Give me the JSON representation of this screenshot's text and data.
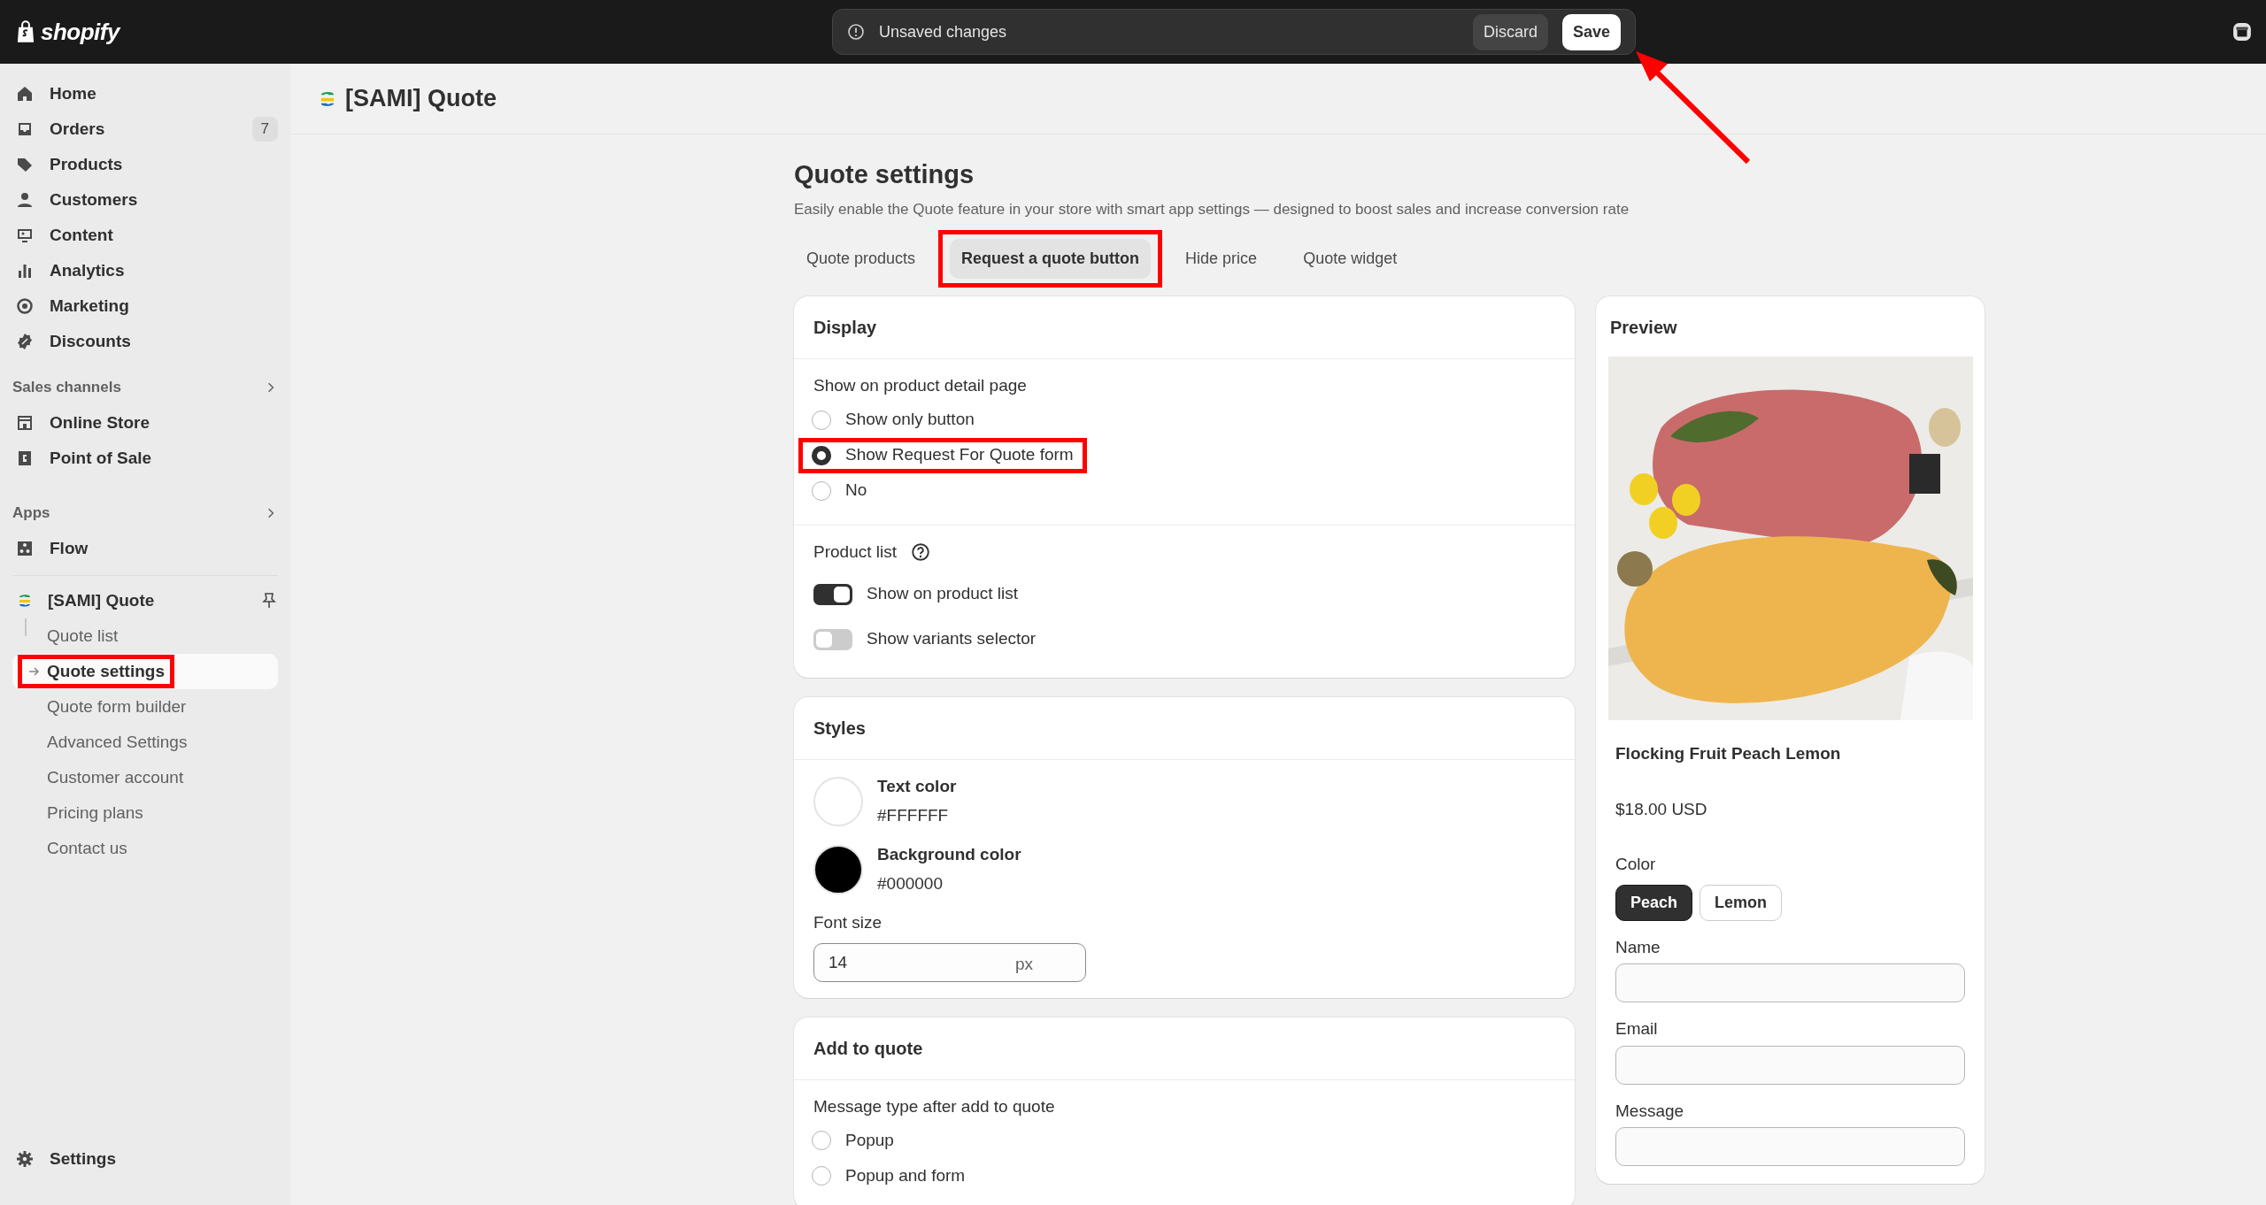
{
  "topbar": {
    "logo": "shopify",
    "message": "Unsaved changes",
    "discard": "Discard",
    "save": "Save"
  },
  "sidebar": {
    "items": [
      {
        "label": "Home"
      },
      {
        "label": "Orders",
        "badge": "7"
      },
      {
        "label": "Products"
      },
      {
        "label": "Customers"
      },
      {
        "label": "Content"
      },
      {
        "label": "Analytics"
      },
      {
        "label": "Marketing"
      },
      {
        "label": "Discounts"
      }
    ],
    "sections": [
      {
        "title": "Sales channels",
        "items": [
          {
            "label": "Online Store"
          },
          {
            "label": "Point of Sale"
          }
        ]
      },
      {
        "title": "Apps",
        "items": [
          {
            "label": "Flow"
          }
        ]
      }
    ],
    "app": {
      "label": "[SAMI] Quote",
      "children": [
        {
          "label": "Quote list",
          "selected": false,
          "highlighted": false
        },
        {
          "label": "Quote settings",
          "selected": true,
          "highlighted": true
        },
        {
          "label": "Quote form builder",
          "selected": false,
          "highlighted": false
        },
        {
          "label": "Advanced Settings",
          "selected": false,
          "highlighted": false
        },
        {
          "label": "Customer account",
          "selected": false,
          "highlighted": false
        },
        {
          "label": "Pricing plans",
          "selected": false,
          "highlighted": false
        },
        {
          "label": "Contact us",
          "selected": false,
          "highlighted": false
        }
      ]
    },
    "footer": "Settings"
  },
  "header": {
    "title": "[SAMI] Quote"
  },
  "page": {
    "title": "Quote settings",
    "subtitle": "Easily enable the Quote feature in your store with smart app settings — designed to boost sales and increase conversion rate"
  },
  "tabs": [
    {
      "label": "Quote products",
      "selected": false,
      "highlighted": false
    },
    {
      "label": "Request a quote button",
      "selected": true,
      "highlighted": true
    },
    {
      "label": "Hide price",
      "selected": false,
      "highlighted": false
    },
    {
      "label": "Quote widget",
      "selected": false,
      "highlighted": false
    }
  ],
  "display": {
    "title": "Display",
    "question": "Show on product detail page",
    "options": [
      {
        "label": "Show only button",
        "selected": false,
        "highlighted": false
      },
      {
        "label": "Show Request For Quote form",
        "selected": true,
        "highlighted": true
      },
      {
        "label": "No",
        "selected": false,
        "highlighted": false
      }
    ],
    "product_list_label": "Product list",
    "toggles": [
      {
        "label": "Show on product list",
        "on": true
      },
      {
        "label": "Show variants selector",
        "on": false
      }
    ]
  },
  "styles": {
    "title": "Styles",
    "colors": [
      {
        "label": "Text color",
        "value": "#FFFFFF",
        "color": "#ffffff"
      },
      {
        "label": "Background color",
        "value": "#000000",
        "color": "#000000"
      }
    ],
    "font_size_label": "Font size",
    "font_size": "14",
    "unit": "px"
  },
  "add_to_quote": {
    "title": "Add to quote",
    "question": "Message type after add to quote",
    "options": [
      {
        "label": "Popup",
        "selected": false
      },
      {
        "label": "Popup and form",
        "selected": false
      }
    ]
  },
  "preview": {
    "title": "Preview",
    "product": "Flocking Fruit Peach Lemon",
    "price": "$18.00 USD",
    "option_label": "Color",
    "chips": [
      {
        "label": "Peach",
        "selected": true
      },
      {
        "label": "Lemon",
        "selected": false
      }
    ],
    "fields": [
      {
        "label": "Name"
      },
      {
        "label": "Email"
      },
      {
        "label": "Message"
      }
    ]
  },
  "annotation_arrow": true
}
